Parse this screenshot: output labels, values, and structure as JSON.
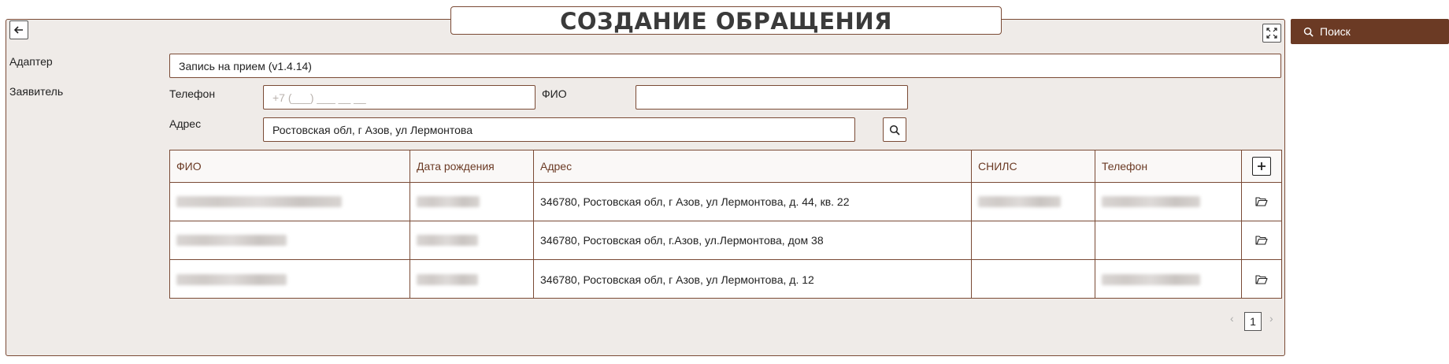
{
  "header": {
    "title": "СОЗДАНИЕ ОБРАЩЕНИЯ"
  },
  "toolbar": {
    "search_label": "Поиск"
  },
  "form": {
    "adapter_label": "Адаптер",
    "adapter_value": "Запись на прием (v1.4.14)",
    "applicant_label": "Заявитель",
    "phone_label": "Телефон",
    "phone_placeholder": "+7 (___) ___ __ __",
    "fio_label": "ФИО",
    "fio_value": "",
    "address_label": "Адрес",
    "address_value": "Ростовская обл, г Азов, ул Лермонтова"
  },
  "table": {
    "columns": [
      "ФИО",
      "Дата рождения",
      "Адрес",
      "СНИЛС",
      "Телефон"
    ],
    "rows": [
      {
        "address": "346780, Ростовская обл, г Азов, ул Лермонтова, д. 44, кв. 22"
      },
      {
        "address": "346780, Ростовская обл, г.Азов, ул.Лермонтова, дом 38"
      },
      {
        "address": "346780, Ростовская обл, г Азов, ул Лермонтова, д. 12"
      }
    ]
  },
  "pagination": {
    "current_page": "1",
    "prev": "‹",
    "next": "›"
  },
  "icons": [
    "back-arrow-icon",
    "fullscreen-icon",
    "search-icon",
    "plus-icon",
    "folder-open-icon"
  ],
  "colors": {
    "accent": "#6b3a24",
    "border": "#7a4a35",
    "panel_bg": "#efebe8"
  }
}
